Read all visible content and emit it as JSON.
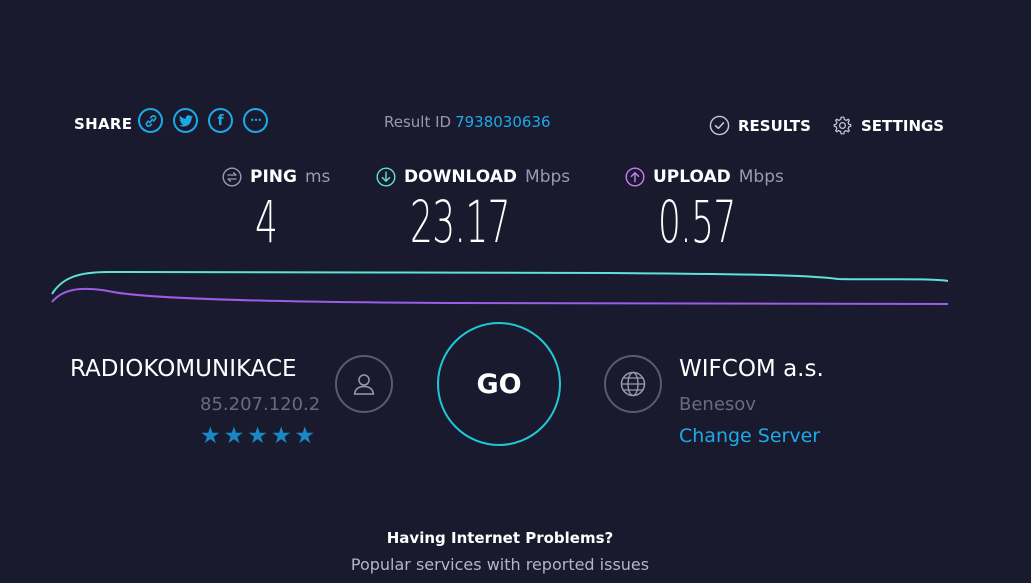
{
  "share": {
    "label": "SHARE",
    "buttons": [
      {
        "name": "link-icon"
      },
      {
        "name": "twitter-icon"
      },
      {
        "name": "facebook-icon",
        "glyph": "f"
      },
      {
        "name": "more-icon",
        "glyph": "•••"
      }
    ]
  },
  "result": {
    "label": "Result ID",
    "id": "7938030636"
  },
  "nav": {
    "results": "RESULTS",
    "settings": "SETTINGS"
  },
  "metrics": {
    "ping": {
      "name": "PING",
      "unit": "ms",
      "value": "4",
      "icon": "ping-icon",
      "color": "#9a9aae"
    },
    "download": {
      "name": "DOWNLOAD",
      "unit": "Mbps",
      "value": "23.17",
      "icon": "download-icon",
      "color": "#5ee2d8"
    },
    "upload": {
      "name": "UPLOAD",
      "unit": "Mbps",
      "value": "0.57",
      "icon": "upload-icon",
      "color": "#c77ef5"
    }
  },
  "graph": {
    "download_color": "#5ee2d8",
    "upload_color": "#9b5de5"
  },
  "isp": {
    "name": "RADIOKOMUNIKACE",
    "ip": "85.207.120.2",
    "stars": "★★★★★",
    "icon": "user-icon"
  },
  "go": {
    "label": "GO"
  },
  "server": {
    "name": "WIFCOM a.s.",
    "location": "Benesov",
    "change_label": "Change Server",
    "icon": "globe-icon"
  },
  "problems": {
    "title": "Having Internet Problems?",
    "subtitle": "Popular services with reported issues"
  },
  "colors": {
    "background": "#1a1a2e",
    "accent": "#1fa8e8",
    "go_ring": "#1fc8d8"
  }
}
